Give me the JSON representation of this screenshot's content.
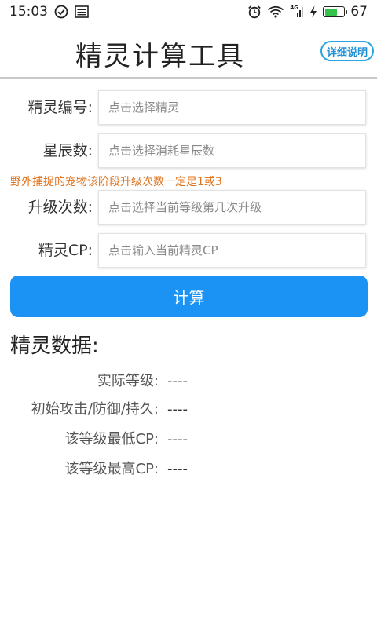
{
  "status_bar": {
    "time": "15:03",
    "network_label": "4G",
    "battery_percent": "67",
    "battery_level": 0.67
  },
  "header": {
    "title": "精灵计算工具",
    "help_button_label": "详细说明"
  },
  "form": {
    "fields": [
      {
        "label": "精灵编号:",
        "placeholder": "点击选择精灵"
      },
      {
        "label": "星辰数:",
        "placeholder": "点击选择消耗星辰数"
      },
      {
        "label": "升级次数:",
        "placeholder": "点击选择当前等级第几次升级"
      },
      {
        "label": "精灵CP:",
        "placeholder": "点击输入当前精灵CP"
      }
    ],
    "warning": "野外捕捉的宠物该阶段升级次数一定是1或3",
    "calculate_label": "计算"
  },
  "results": {
    "title": "精灵数据:",
    "rows": [
      {
        "label": "实际等级:",
        "value": "----"
      },
      {
        "label": "初始攻击/防御/持久:",
        "value": "----"
      },
      {
        "label": "该等级最低CP:",
        "value": "----"
      },
      {
        "label": "该等级最高CP:",
        "value": "----"
      }
    ]
  },
  "colors": {
    "accent": "#1a93f4",
    "warning": "#e0731e",
    "battery": "#35c24a"
  }
}
